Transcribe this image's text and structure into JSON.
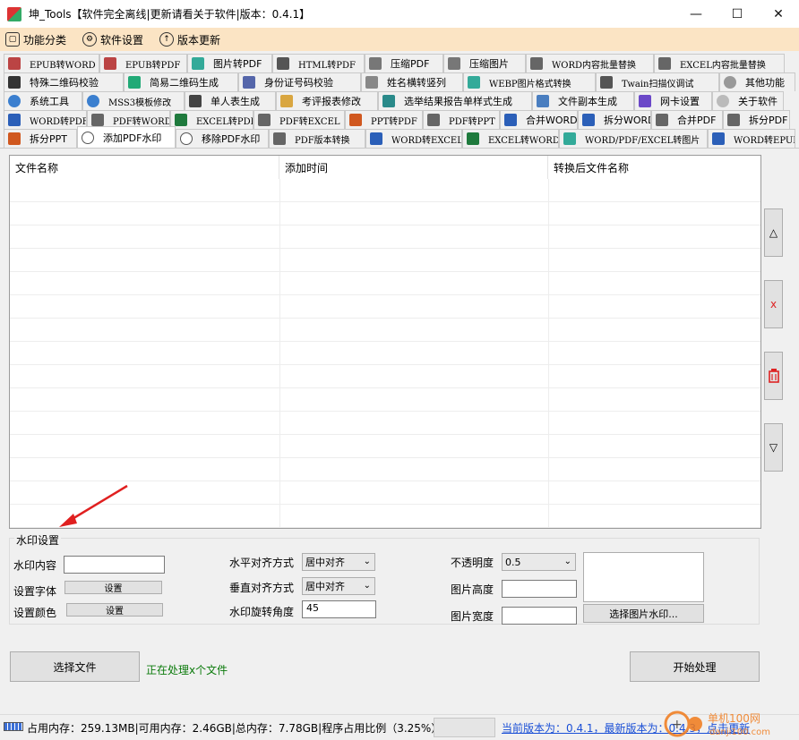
{
  "window": {
    "title": "坤_Tools【软件完全离线|更新请看关于软件|版本：0.4.1】",
    "controls": [
      "—",
      "☐",
      "✕"
    ]
  },
  "menu": {
    "items": [
      {
        "label": "功能分类",
        "icon": "cube-icon"
      },
      {
        "label": "软件设置",
        "icon": "gear-icon"
      },
      {
        "label": "版本更新",
        "icon": "up-arrow-icon"
      }
    ]
  },
  "tabs": {
    "row1": [
      "EPUB转WORD",
      "EPUB转PDF",
      "图片转PDF",
      "HTML转PDF",
      "压缩PDF",
      "压缩图片",
      "WORD内容批量替换",
      "EXCEL内容批量替换"
    ],
    "row2": [
      "特殊二维码校验",
      "简易二维码生成",
      "身份证号码校验",
      "姓名横转竖列",
      "WEBP图片格式转换",
      "Twain扫描仪调试",
      "其他功能"
    ],
    "row3": [
      "系统工具",
      "MSS3模板修改",
      "单人表生成",
      "考评报表修改",
      "选举结果报告单样式生成",
      "文件副本生成",
      "网卡设置",
      "关于软件"
    ],
    "row4": [
      "WORD转PDF",
      "PDF转WORD",
      "EXCEL转PDF",
      "PDF转EXCEL",
      "PPT转PDF",
      "PDF转PPT",
      "合并WORD",
      "拆分WORD",
      "合并PDF",
      "拆分PDF"
    ],
    "row5": [
      "拆分PPT",
      "添加PDF水印",
      "移除PDF水印",
      "PDF版本转换",
      "WORD转EXCEL",
      "EXCEL转WORD",
      "WORD/PDF/EXCEL转图片",
      "WORD转EPUB"
    ],
    "active": "添加PDF水印"
  },
  "table": {
    "columns": [
      "文件名称",
      "添加时间",
      "转换后文件名称"
    ],
    "rows": []
  },
  "side_buttons": {
    "up": "△",
    "delete": "x",
    "clear": "clear-icon",
    "down": "▽"
  },
  "watermark": {
    "group_title": "水印设置",
    "content_label": "水印内容",
    "content_value": "",
    "font_label": "设置字体",
    "font_button": "设置",
    "color_label": "设置颜色",
    "color_button": "设置",
    "h_align_label": "水平对齐方式",
    "h_align_value": "居中对齐",
    "v_align_label": "垂直对齐方式",
    "v_align_value": "居中对齐",
    "rotation_label": "水印旋转角度",
    "rotation_value": "45",
    "opacity_label": "不透明度",
    "opacity_value": "0.5",
    "img_height_label": "图片高度",
    "img_height_value": "",
    "img_width_label": "图片宽度",
    "img_width_value": "",
    "select_image_button": "选择图片水印..."
  },
  "actions": {
    "select_file": "选择文件",
    "processing_text": "正在处理x个文件",
    "start": "开始处理"
  },
  "status": {
    "memory_text": "占用内存：259.13MB|可用内存：2.46GB|总内存：7.78GB|程序占用比例（3.25%）",
    "version_link": "当前版本为：0.4.1，最新版本为：0.4.3，点击更新"
  },
  "overlay_watermark": "单机100网 danji100.com",
  "colors": {
    "menu_bg": "#fbe4c4",
    "link": "#1a4fd6",
    "processing": "#0a7a0a",
    "arrow": "#e02020"
  }
}
